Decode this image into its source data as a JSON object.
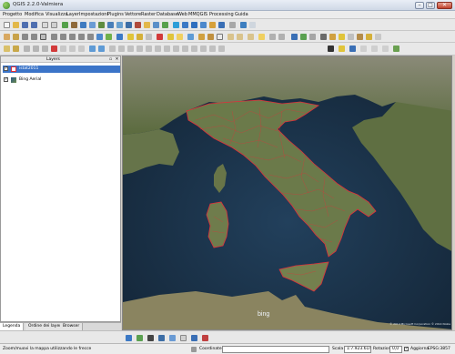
{
  "window": {
    "title": "QGIS 2.2.0-Valmiera",
    "min_glyph": "–",
    "max_glyph": "□",
    "close_glyph": "✕"
  },
  "menubar": [
    "Progetto",
    "Modifica",
    "Visualizza",
    "Layer",
    "Impostazioni",
    "Plugins",
    "Vettore",
    "Raster",
    "Database",
    "Web",
    "MMQGIS",
    "Processing",
    "Guida"
  ],
  "layers_panel": {
    "title": "Layers",
    "close_glyph": "✕",
    "float_glyph": "▫",
    "layers": [
      {
        "name": "istat2011",
        "checked": true,
        "selected": true
      },
      {
        "name": "Bing Aerial",
        "checked": true,
        "selected": false
      }
    ]
  },
  "panel_tabs": [
    "Legenda",
    "Ordine dei layer",
    "Browser"
  ],
  "map": {
    "attribution_logo": "bing",
    "copyright": "© 2014 Microsoft Corporation © 2014 Nokia"
  },
  "statusbar": {
    "message": "Zoom/muovi la mappa utilizzando le frecce",
    "coord_label": "Coordinate",
    "coord_value": "",
    "scale_label": "Scala",
    "scale_value": "1:7.923.614",
    "rotation_label": "Rotazione",
    "rotation_value": "0,0",
    "render_label": "Aggiorna",
    "crs_value": "EPSG:3857"
  },
  "colors": {
    "accent": "#3b74c8",
    "boundary": "#e0303a",
    "sea": "#1e3246",
    "land": "#6b7a4a"
  }
}
